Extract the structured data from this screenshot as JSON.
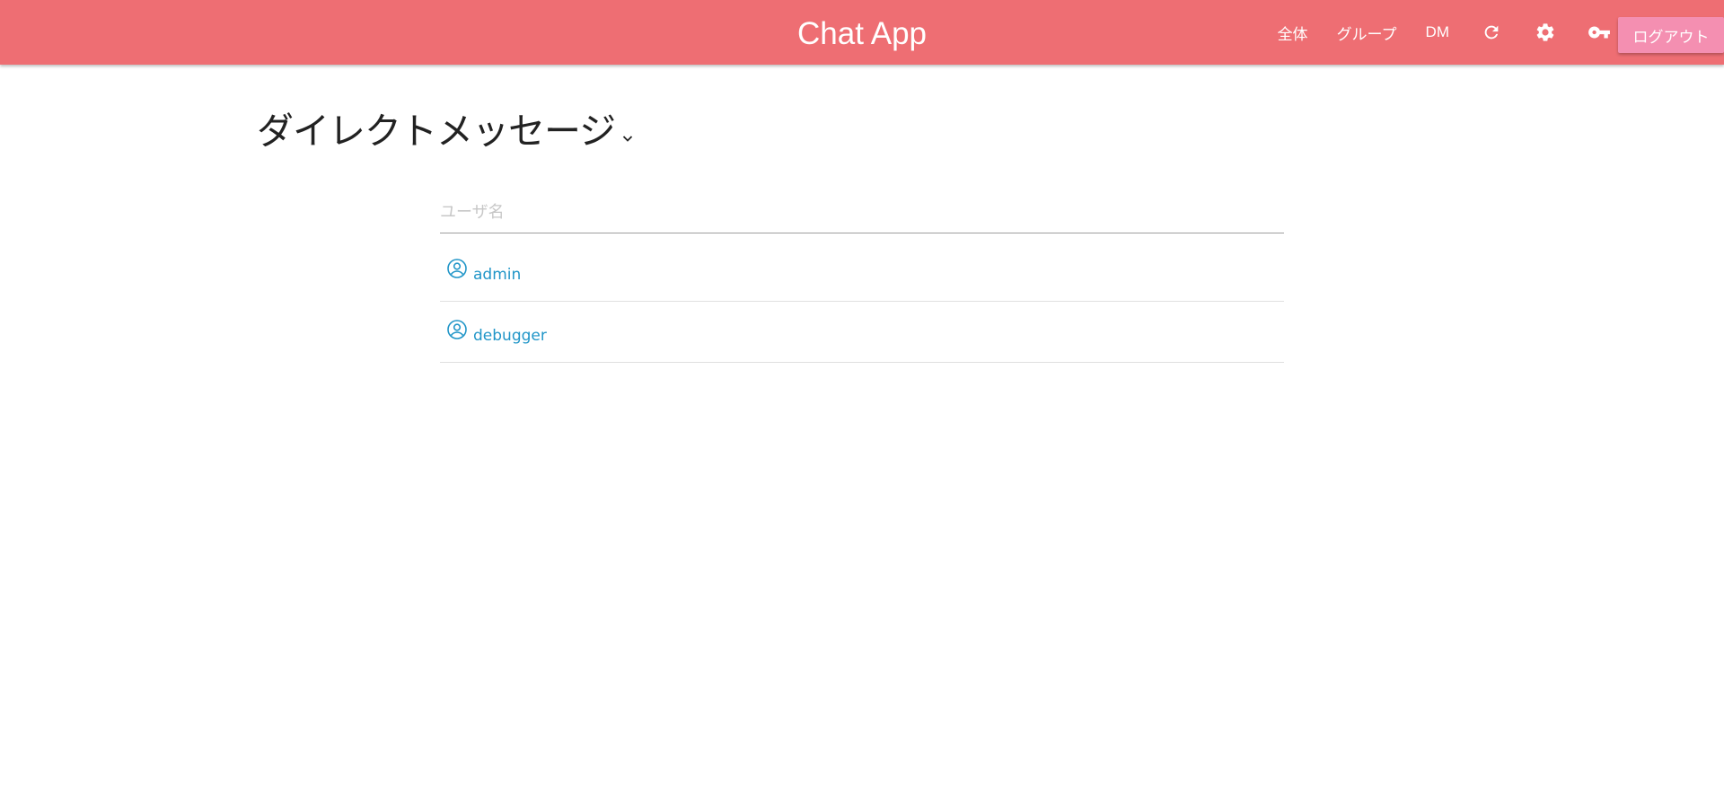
{
  "header": {
    "title": "Chat App",
    "nav": {
      "all": "全体",
      "group": "グループ",
      "dm": "DM"
    },
    "icons": [
      "refresh-icon",
      "gear-icon",
      "key-icon"
    ],
    "logout_label": "ログアウト",
    "bg_color": "#ee6e73",
    "logout_color": "#f48fb1"
  },
  "main": {
    "title": "ダイレクトメッセージ",
    "search": {
      "placeholder": "ユーザ名",
      "value": ""
    },
    "users": [
      {
        "name": "admin",
        "icon": "user-circle-icon"
      },
      {
        "name": "debugger",
        "icon": "user-circle-icon"
      }
    ],
    "link_color": "#2196c8"
  }
}
